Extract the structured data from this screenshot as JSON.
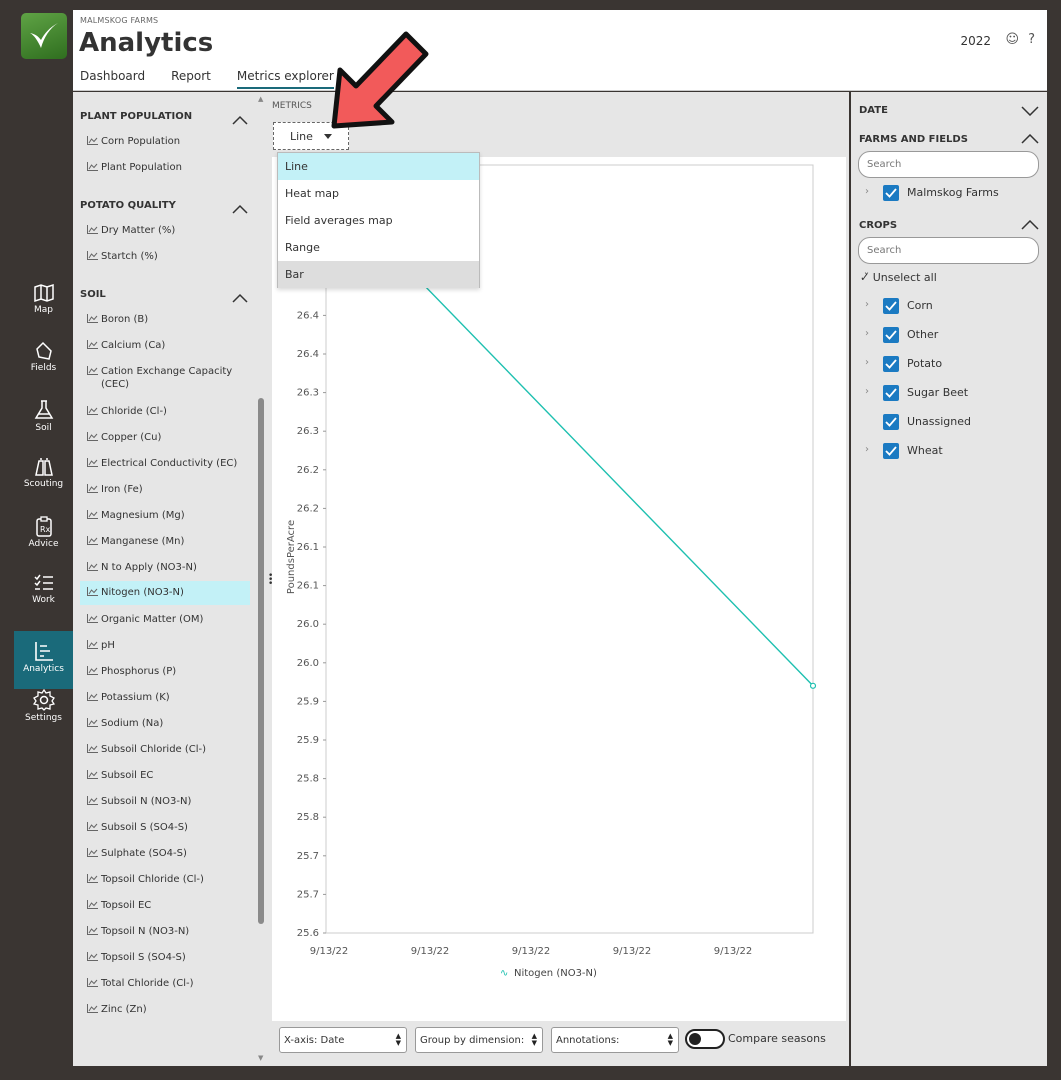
{
  "header": {
    "org": "MALMSKOG FARMS",
    "title": "Analytics",
    "tabs": [
      {
        "label": "Dashboard"
      },
      {
        "label": "Report"
      },
      {
        "label": "Metrics explorer"
      }
    ],
    "year": "2022"
  },
  "nav": [
    {
      "label": "Map"
    },
    {
      "label": "Fields"
    },
    {
      "label": "Soil"
    },
    {
      "label": "Scouting"
    },
    {
      "label": "Advice"
    },
    {
      "label": "Work"
    },
    {
      "label": "Analytics"
    },
    {
      "label": "Settings"
    }
  ],
  "sidebar": {
    "sections": [
      {
        "title": "PLANT POPULATION",
        "items": [
          "Corn Population",
          "Plant Population"
        ]
      },
      {
        "title": "POTATO QUALITY",
        "items": [
          "Dry Matter (%)",
          "Startch (%)"
        ]
      },
      {
        "title": "SOIL",
        "items": [
          "Boron (B)",
          "Calcium (Ca)",
          "Cation Exchange Capacity (CEC)",
          "Chloride (Cl-)",
          "Copper (Cu)",
          "Electrical Conductivity (EC)",
          "Iron (Fe)",
          "Magnesium (Mg)",
          "Manganese (Mn)",
          "N to Apply (NO3-N)",
          "Nitogen (NO3-N)",
          "Organic Matter (OM)",
          "pH",
          "Phosphorus (P)",
          "Potassium (K)",
          "Sodium (Na)",
          "Subsoil Chloride (Cl-)",
          "Subsoil EC",
          "Subsoil N (NO3-N)",
          "Subsoil S (SO4-S)",
          "Sulphate (SO4-S)",
          "Topsoil Chloride (Cl-)",
          "Topsoil EC",
          "Topsoil N (NO3-N)",
          "Topsoil S (SO4-S)",
          "Total Chloride (Cl-)",
          "Zinc (Zn)"
        ]
      }
    ],
    "selected": "Nitogen (NO3-N)"
  },
  "main": {
    "metrics_label": "METRICS",
    "chart_type_selected": "Line",
    "dropdown_options": [
      "Line",
      "Heat map",
      "Field averages map",
      "Range",
      "Bar"
    ],
    "bottom": {
      "xaxis": "X-axis: Date",
      "group": "Group by dimension:",
      "annotations": "Annotations:",
      "compare": "Compare seasons"
    }
  },
  "chart_data": {
    "type": "line",
    "ylabel": "PoundsPerAcre",
    "y_ticks": [
      "25.6",
      "25.7",
      "25.7",
      "25.8",
      "25.8",
      "25.9",
      "25.9",
      "26.0",
      "26.0",
      "26.1",
      "26.1",
      "26.2",
      "26.2",
      "26.3",
      "26.3",
      "26.4",
      "26.4"
    ],
    "x_ticks": [
      "9/13/22",
      "9/13/22",
      "9/13/22",
      "9/13/22",
      "9/13/22"
    ],
    "series": [
      {
        "name": "Nitogen (NO3-N)",
        "color": "#1ec0b0",
        "x": [
          "9/13/22",
          "9/13/22"
        ],
        "y": [
          26.54,
          25.92
        ]
      }
    ],
    "ylim": [
      25.6,
      26.6
    ]
  },
  "right": {
    "date_label": "DATE",
    "farms_label": "FARMS AND FIELDS",
    "search_placeholder": "Search",
    "farm": "Malmskog Farms",
    "crops_label": "CROPS",
    "unselect": "Unselect all",
    "crops": [
      {
        "name": "Corn",
        "expand": true
      },
      {
        "name": "Other",
        "expand": true
      },
      {
        "name": "Potato",
        "expand": true
      },
      {
        "name": "Sugar Beet",
        "expand": true
      },
      {
        "name": "Unassigned",
        "expand": false
      },
      {
        "name": "Wheat",
        "expand": true
      }
    ]
  },
  "colors": {
    "accent": "#1a6a7a",
    "line": "#1ec0b0",
    "checkbox": "#1b7ac2",
    "highlight": "#c3f1f7"
  }
}
